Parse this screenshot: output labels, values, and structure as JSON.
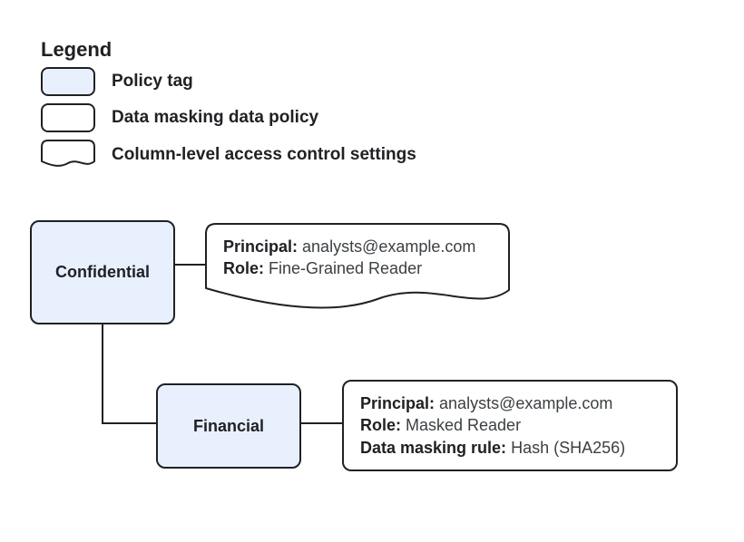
{
  "legend": {
    "title": "Legend",
    "items": {
      "policy_tag": "Policy tag",
      "data_masking": "Data masking data policy",
      "column_access": "Column-level access control settings"
    }
  },
  "nodes": {
    "confidential": {
      "label": "Confidential",
      "detail": {
        "principal_label": "Principal:",
        "principal_value": " analysts@example.com",
        "role_label": "Role:",
        "role_value": " Fine-Grained Reader"
      }
    },
    "financial": {
      "label": "Financial",
      "detail": {
        "principal_label": "Principal:",
        "principal_value": " analysts@example.com",
        "role_label": "Role:",
        "role_value": " Masked Reader",
        "rule_label": "Data masking rule:",
        "rule_value": " Hash (SHA256)"
      }
    }
  },
  "colors": {
    "policy_tag_fill": "#e8f0fe",
    "stroke": "#202124",
    "text": "#3c4043"
  }
}
